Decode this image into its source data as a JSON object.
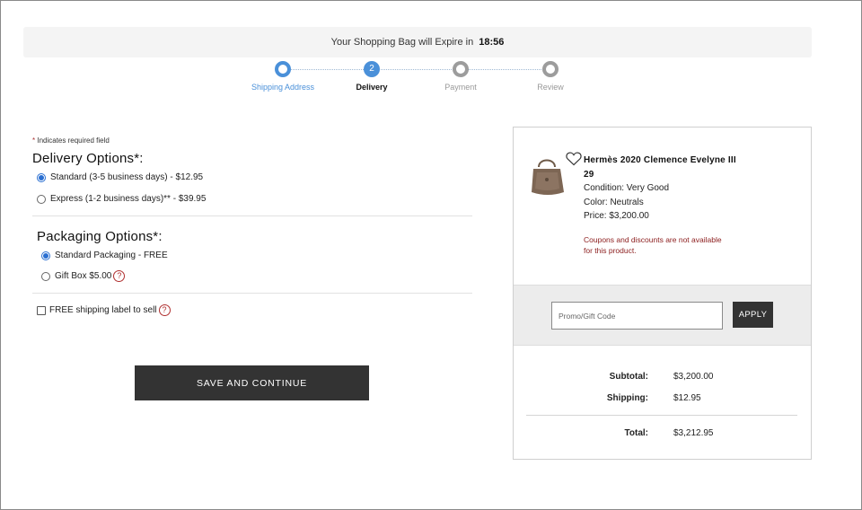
{
  "expire": {
    "message": "Your Shopping Bag will Expire in",
    "time": "18:56"
  },
  "stepper": {
    "steps": [
      {
        "label": "Shipping Address",
        "state": "done"
      },
      {
        "label": "Delivery",
        "state": "active",
        "number": "2"
      },
      {
        "label": "Payment",
        "state": "todo"
      },
      {
        "label": "Review",
        "state": "todo"
      }
    ]
  },
  "form": {
    "required_note_star": "*",
    "required_note": "Indicates required field",
    "delivery": {
      "title": "Delivery Options*:",
      "options": [
        {
          "label": "Standard (3-5 business days) - $12.95",
          "selected": true
        },
        {
          "label": "Express (1-2 business days)** - $39.95",
          "selected": false
        }
      ]
    },
    "packaging": {
      "title": "Packaging Options*:",
      "options": [
        {
          "label": "Standard Packaging - FREE",
          "selected": true
        },
        {
          "label": "Gift Box $5.00",
          "selected": false
        }
      ]
    },
    "shipping_label": {
      "label": "FREE shipping label to sell",
      "checked": false
    },
    "help_glyph": "?",
    "save_label": "SAVE AND CONTINUE"
  },
  "summary": {
    "product": {
      "name": "Hermès 2020 Clemence Evelyne III 29",
      "condition": "Condition: Very Good",
      "color": "Color: Neutrals",
      "price": "Price: $3,200.00",
      "notice": "Coupons and discounts are not available for this product."
    },
    "promo": {
      "placeholder": "Promo/Gift Code",
      "apply_label": "APPLY"
    },
    "totals": {
      "subtotal_label": "Subtotal:",
      "subtotal_value": "$3,200.00",
      "shipping_label": "Shipping:",
      "shipping_value": "$12.95",
      "total_label": "Total:",
      "total_value": "$3,212.95"
    }
  },
  "colors": {
    "accent": "#4a90d9",
    "button": "#333333",
    "warning": "#8b1c1c",
    "inactive": "#9c9c9c"
  }
}
